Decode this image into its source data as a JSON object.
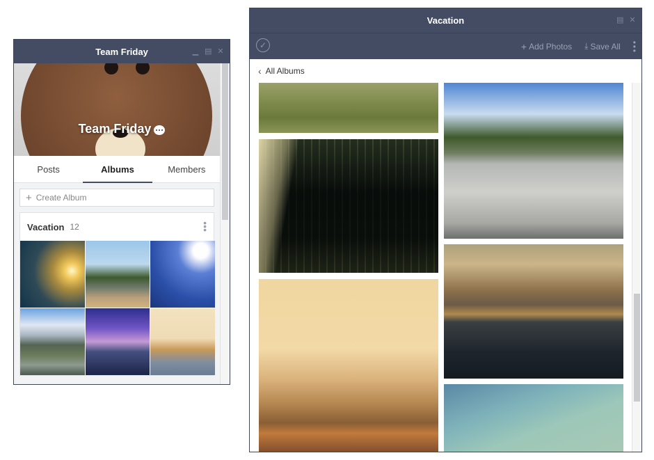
{
  "left_window": {
    "title": "Team Friday",
    "controls": [
      "minimize-icon",
      "maximize-icon",
      "close-icon"
    ],
    "cover": {
      "group_name": "Team Friday"
    },
    "tabs": [
      {
        "label": "Posts",
        "active": false
      },
      {
        "label": "Albums",
        "active": true
      },
      {
        "label": "Members",
        "active": false
      }
    ],
    "create_album": {
      "placeholder": "Create Album"
    },
    "album": {
      "name": "Vacation",
      "count": "12"
    }
  },
  "right_window": {
    "title": "Vacation",
    "controls": [
      "maximize-icon",
      "close-icon"
    ],
    "toolbar": {
      "select_icon": "check-circle-icon",
      "add_photos": "Add Photos",
      "save_all": "Save All"
    },
    "nav": {
      "back_label": "All Albums"
    }
  },
  "colors": {
    "titlebar": "#444c63",
    "active_tab_underline": "#444c63",
    "background": "#f2f3f5"
  }
}
